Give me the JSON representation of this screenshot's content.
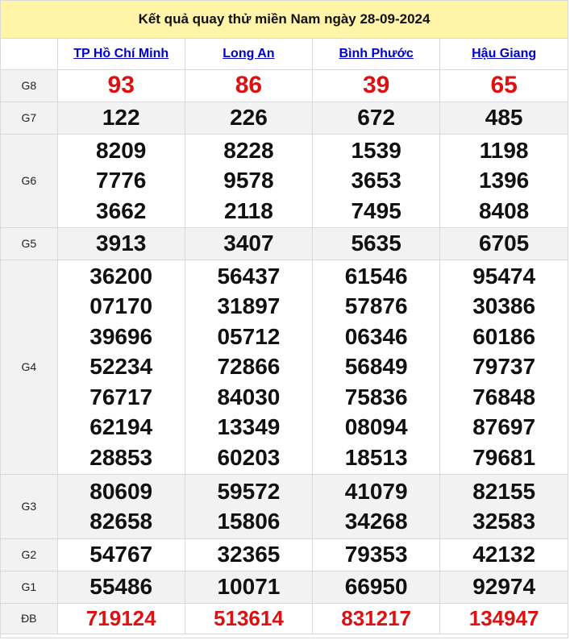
{
  "title": "Kết quả quay thử miền Nam ngày 28-09-2024",
  "provinces": [
    "TP Hồ Chí Minh",
    "Long An",
    "Bình Phước",
    "Hậu Giang"
  ],
  "prizes": [
    {
      "label": "G8",
      "values": [
        [
          "93"
        ],
        [
          "86"
        ],
        [
          "39"
        ],
        [
          "65"
        ]
      ]
    },
    {
      "label": "G7",
      "values": [
        [
          "122"
        ],
        [
          "226"
        ],
        [
          "672"
        ],
        [
          "485"
        ]
      ]
    },
    {
      "label": "G6",
      "values": [
        [
          "8209",
          "7776",
          "3662"
        ],
        [
          "8228",
          "9578",
          "2118"
        ],
        [
          "1539",
          "3653",
          "7495"
        ],
        [
          "1198",
          "1396",
          "8408"
        ]
      ]
    },
    {
      "label": "G5",
      "values": [
        [
          "3913"
        ],
        [
          "3407"
        ],
        [
          "5635"
        ],
        [
          "6705"
        ]
      ]
    },
    {
      "label": "G4",
      "values": [
        [
          "36200",
          "07170",
          "39696",
          "52234",
          "76717",
          "62194",
          "28853"
        ],
        [
          "56437",
          "31897",
          "05712",
          "72866",
          "84030",
          "13349",
          "60203"
        ],
        [
          "61546",
          "57876",
          "06346",
          "56849",
          "75836",
          "08094",
          "18513"
        ],
        [
          "95474",
          "30386",
          "60186",
          "79737",
          "76848",
          "87697",
          "79681"
        ]
      ]
    },
    {
      "label": "G3",
      "values": [
        [
          "80609",
          "82658"
        ],
        [
          "59572",
          "15806"
        ],
        [
          "41079",
          "34268"
        ],
        [
          "82155",
          "32583"
        ]
      ]
    },
    {
      "label": "G2",
      "values": [
        [
          "54767"
        ],
        [
          "32365"
        ],
        [
          "79353"
        ],
        [
          "42132"
        ]
      ]
    },
    {
      "label": "G1",
      "values": [
        [
          "55486"
        ],
        [
          "10071"
        ],
        [
          "66950"
        ],
        [
          "92974"
        ]
      ]
    },
    {
      "label": "ĐB",
      "values": [
        [
          "719124"
        ],
        [
          "513614"
        ],
        [
          "831217"
        ],
        [
          "134947"
        ]
      ]
    }
  ],
  "colors": {
    "header_background": "#fff4a8",
    "province_link": "#0000cc",
    "highlight_red": "#dd1111",
    "row_shade": "#f2f2f2",
    "grid_line": "#d9d9d9"
  }
}
